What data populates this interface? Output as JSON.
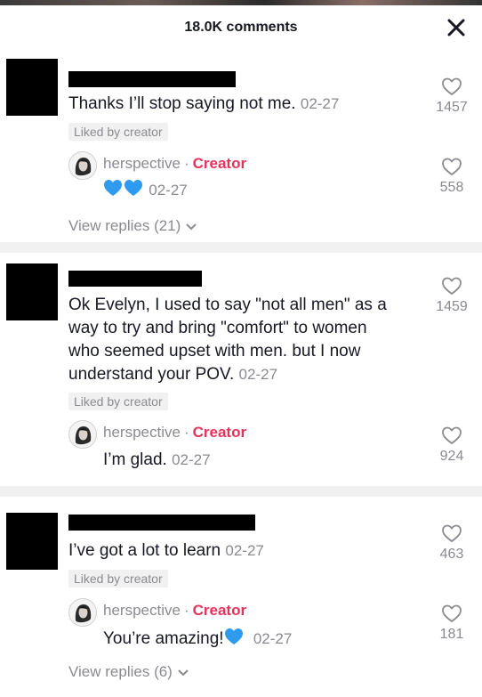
{
  "header": {
    "title": "18.0K comments",
    "close_icon": "close-icon"
  },
  "comments": [
    {
      "text": "Thanks I’ll stop saying not me.",
      "date": "02-27",
      "liked_by": "Liked by creator",
      "likes": "1457",
      "reply": {
        "name": "herspective",
        "dot": "·",
        "creator": "Creator",
        "text": "",
        "emoji": "💙💙",
        "date": "02-27",
        "likes": "558"
      },
      "view_replies": "View replies (21)"
    },
    {
      "text": "Ok Evelyn, I used to say \"not all men\" as a way to try and bring \"comfort\" to women who seemed upset with men. but I now understand your POV.",
      "line1": "Ok Evelyn, I used to say \"not all men\" as a",
      "line2": "way to try and bring \"comfort\" to women",
      "line3": "who seemed upset with men. but I now",
      "line4": "understand your POV.",
      "date": "02-27",
      "liked_by": "Liked by creator",
      "likes": "1459",
      "reply": {
        "name": "herspective",
        "dot": "·",
        "creator": "Creator",
        "text": "I’m glad.",
        "date": "02-27",
        "likes": "924"
      }
    },
    {
      "text": "I’ve got a lot to learn",
      "date": "02-27",
      "liked_by": "Liked by creator",
      "likes": "463",
      "reply": {
        "name": "herspective",
        "dot": "·",
        "creator": "Creator",
        "text": "You’re amazing!",
        "date": "02-27",
        "likes": "181"
      },
      "view_replies": "View replies (6)"
    }
  ],
  "colors": {
    "creator": "#e8325a",
    "muted": "#8a8b91",
    "heart_blue": "#2f9bf0",
    "divider": "#f1f1f2"
  }
}
